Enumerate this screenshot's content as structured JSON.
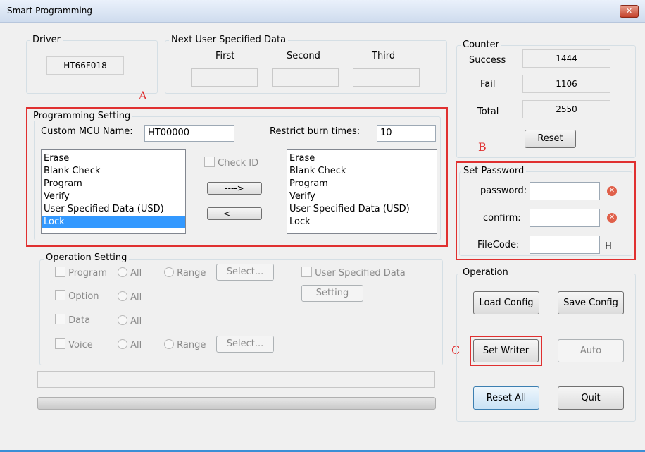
{
  "window": {
    "title": "Smart Programming",
    "close_icon": "close-icon"
  },
  "driver": {
    "legend": "Driver",
    "value": "HT66F018"
  },
  "usd": {
    "legend": "Next User Specified Data",
    "first": "First",
    "second": "Second",
    "third": "Third"
  },
  "counter": {
    "legend": "Counter",
    "success_label": "Success",
    "success_value": "1444",
    "fail_label": "Fail",
    "fail_value": "1106",
    "total_label": "Total",
    "total_value": "2550",
    "reset_label": "Reset"
  },
  "annotations": {
    "a": "A",
    "b": "B",
    "c": "C",
    "color": "#e03030"
  },
  "programming": {
    "legend": "Programming Setting",
    "mcu_label": "Custom MCU Name:",
    "mcu_value": "HT00000",
    "restrict_label": "Restrict burn times:",
    "restrict_value": "10",
    "check_id": "Check ID",
    "right_arrow": "---->",
    "left_arrow": "<-----",
    "left_list": [
      "Erase",
      "Blank Check",
      "Program",
      "Verify",
      "User Specified Data (USD)",
      "Lock"
    ],
    "left_selected": "Lock",
    "right_list": [
      "Erase",
      "Blank Check",
      "Program",
      "Verify",
      "User Specified Data (USD)",
      "Lock"
    ]
  },
  "password": {
    "legend": "Set Password",
    "password_label": "password:",
    "confirm_label": "confirm:",
    "filecode_label": "FileCode:",
    "filecode_suffix": "H",
    "error_icon": "error-icon"
  },
  "operation_setting": {
    "legend": "Operation Setting",
    "program": "Program",
    "option": "Option",
    "data": "Data",
    "voice": "Voice",
    "all": "All",
    "range": "Range",
    "select": "Select...",
    "usd": "User Specified Data",
    "setting": "Setting"
  },
  "operation": {
    "legend": "Operation",
    "load_config": "Load Config",
    "save_config": "Save Config",
    "set_writer": "Set Writer",
    "auto": "Auto",
    "reset_all": "Reset All",
    "quit": "Quit"
  }
}
